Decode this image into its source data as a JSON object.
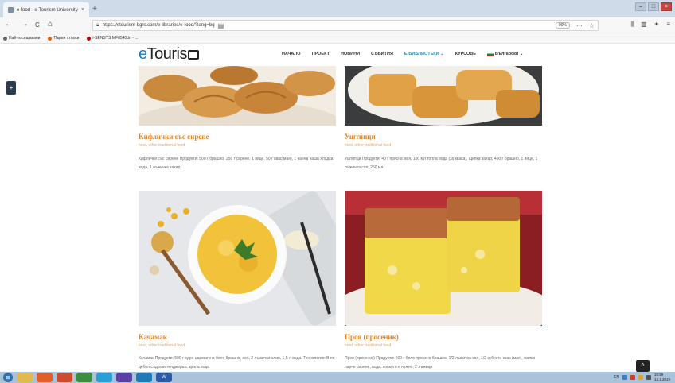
{
  "browser": {
    "tab_title": "e-food - e-Tourism University",
    "tab_close": "×",
    "new_tab": "+",
    "url": "https://etourism-bgrs.com/e-libraries/e-food/?lang=bg",
    "zoom": "90%",
    "back": "←",
    "forward": "→",
    "reload": "C",
    "home": "⌂",
    "more": "···",
    "bookmark_star": "☆",
    "menu_icon": "≡"
  },
  "bookmarks": [
    {
      "label": "Най-посещавани",
      "color": "#666"
    },
    {
      "label": "Първи стъпки",
      "color": "#e66000"
    },
    {
      "label": "i-SENSYS MF8540dn - ...",
      "color": "#c00"
    }
  ],
  "site": {
    "logo_e": "e",
    "logo_rest": "Touris",
    "menu": [
      {
        "label": "НАЧАЛО",
        "active": false
      },
      {
        "label": "ПРОЕКТ",
        "active": false
      },
      {
        "label": "НОВИНИ",
        "active": false
      },
      {
        "label": "СЪБИТИЯ",
        "active": false
      },
      {
        "label": "E-БИБЛИОТЕКИ ⌄",
        "active": true
      },
      {
        "label": "КУРСОВЕ",
        "active": false
      }
    ],
    "language": "Български ⌄",
    "side_button": "+",
    "scroll_top": "^"
  },
  "recipes": [
    {
      "title": "Кифлички със сирене",
      "categories": "food, other traditional food",
      "description": "Кифлички със сирене Продукти: 500 г брашно, 250 г сирене, 1 яйце, 50 г квас(мая), 1 чаена чаша хладка вода, 1 лъжичка захар,"
    },
    {
      "title": "Уштипци",
      "categories": "food, other traditional food",
      "description": "Уштипци Продукти: 40 г прясна мая, 100 мл топла вода (за кваса), щипка захар, 400 г брашно, 1 яйце, 1 лъжичка сол, 250 мл"
    },
    {
      "title": "Качамак",
      "categories": "food, other traditional food",
      "description": "Качамак Продукти: 500 г едро царевично бяло брашно, сол, 2 лъжички олио, 1,5 л вода. Технология: В по-дебел съд или тенджера с вряла вода"
    },
    {
      "title": "Проя (просеник)",
      "categories": "food, other traditional food",
      "description": "Проя (просеник) Продукти: 500 г бяло просено брашно, 1/2 лъжичка сол, 1/2 кубчета квас (мая), малко парче сирене, вода, колкото е нужно, 2 лъжици"
    }
  ],
  "taskbar": {
    "time": "10:59",
    "date": "14.1.2019",
    "lang": "EN"
  }
}
